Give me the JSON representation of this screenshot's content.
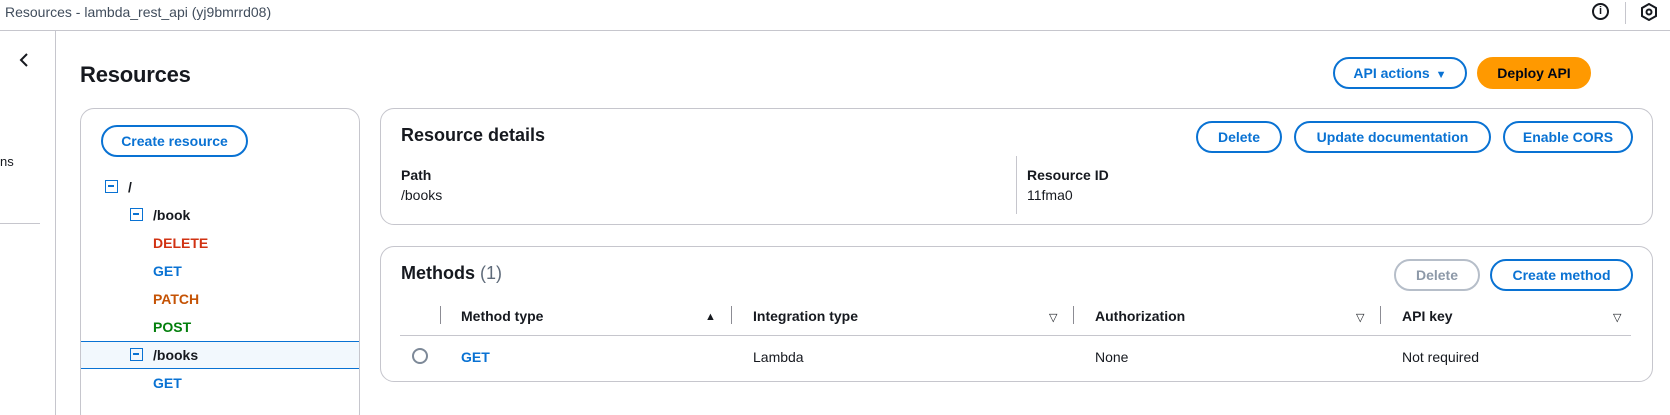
{
  "window": {
    "title": "Resources - lambda_rest_api (yj9bmrrd08)"
  },
  "topbar": {
    "info_icon": "info-icon",
    "settings_icon": "settings-icon"
  },
  "leftnav": {
    "clipped_text": "ns"
  },
  "page": {
    "title": "Resources",
    "api_actions_label": "API actions",
    "deploy_label": "Deploy API"
  },
  "tree": {
    "create_resource_label": "Create resource",
    "root": "/",
    "book": "/book",
    "book_methods": [
      "DELETE",
      "GET",
      "PATCH",
      "POST"
    ],
    "books": "/books",
    "books_methods": [
      "GET"
    ]
  },
  "details": {
    "title": "Resource details",
    "delete_label": "Delete",
    "update_doc_label": "Update documentation",
    "enable_cors_label": "Enable CORS",
    "path_label": "Path",
    "path_value": "/books",
    "resource_id_label": "Resource ID",
    "resource_id_value": "11fma0"
  },
  "methods": {
    "title": "Methods",
    "count": "(1)",
    "delete_label": "Delete",
    "create_label": "Create method",
    "columns": [
      "Method type",
      "Integration type",
      "Authorization",
      "API key"
    ],
    "rows": [
      {
        "method": "GET",
        "integration": "Lambda",
        "authorization": "None",
        "api_key": "Not required"
      }
    ]
  },
  "colors": {
    "accent": "#0972d3",
    "primary_button": "#ff9900",
    "delete_method": "#d13212",
    "patch_method": "#c55305",
    "post_method": "#037f0c"
  }
}
